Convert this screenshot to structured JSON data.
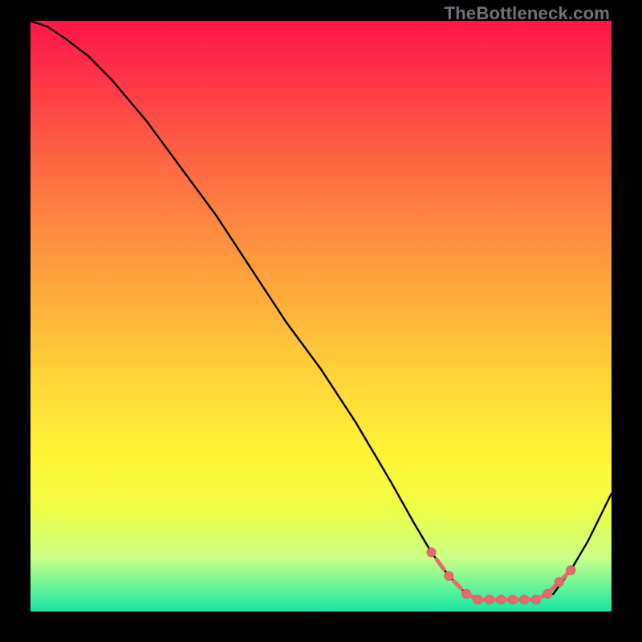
{
  "watermark": "TheBottleneck.com",
  "colors": {
    "curve": "#000000",
    "marker_fill": "#e86b6b",
    "marker_stroke": "#d85a5a"
  },
  "chart_data": {
    "type": "line",
    "title": "",
    "xlabel": "",
    "ylabel": "",
    "xlim": [
      0,
      100
    ],
    "ylim": [
      0,
      100
    ],
    "grid": false,
    "series": [
      {
        "name": "bottleneck-curve",
        "x": [
          0,
          3,
          6,
          10,
          14,
          20,
          26,
          32,
          38,
          44,
          50,
          56,
          62,
          66,
          69,
          72,
          75,
          78,
          82,
          86,
          90,
          93,
          96,
          100
        ],
        "values": [
          100,
          99,
          97,
          94,
          90,
          83,
          75,
          67,
          58,
          49,
          41,
          32,
          22,
          15,
          10,
          6,
          3,
          2,
          2,
          2,
          3,
          7,
          12,
          20
        ]
      }
    ],
    "markers": {
      "name": "highlighted-points",
      "x": [
        69,
        72,
        75,
        77,
        79,
        81,
        83,
        85,
        87,
        89,
        91,
        93
      ],
      "values": [
        10,
        6,
        3,
        2,
        2,
        2,
        2,
        2,
        2,
        3,
        5,
        7
      ]
    }
  }
}
